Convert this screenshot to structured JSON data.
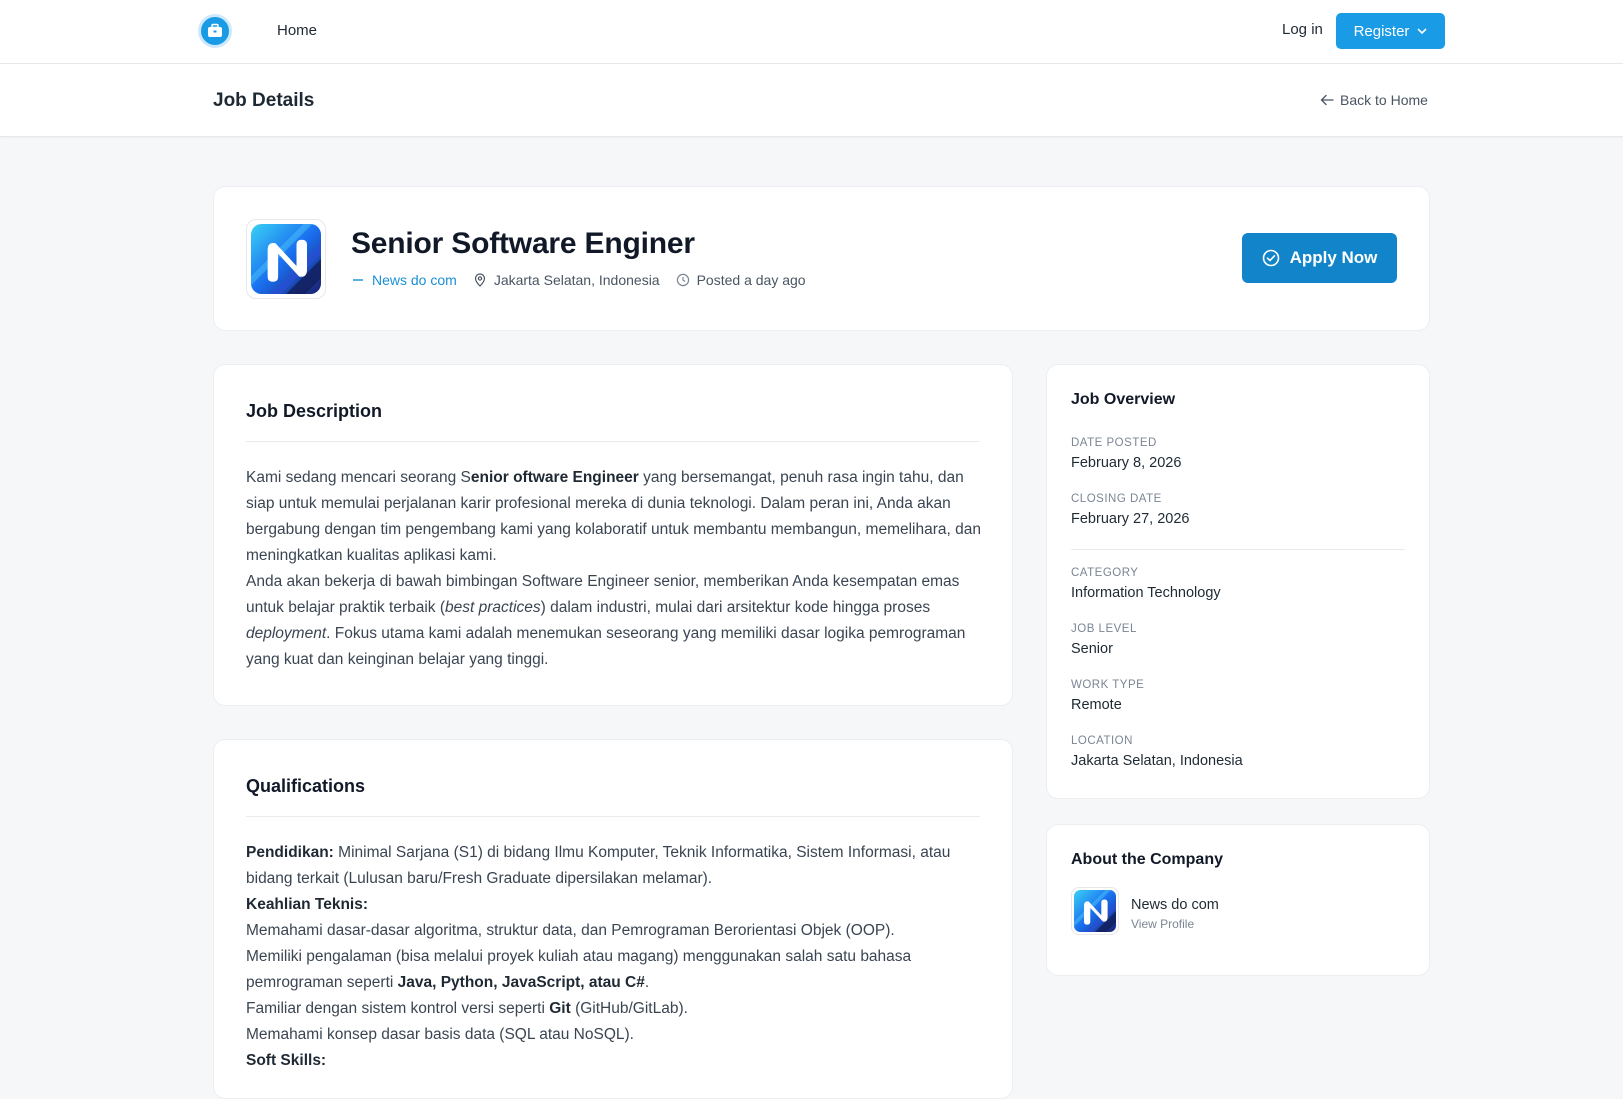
{
  "nav": {
    "home_label": "Home",
    "login_label": "Log in",
    "register_label": "Register"
  },
  "subheader": {
    "title": "Job Details",
    "back_label": "Back to Home"
  },
  "job": {
    "title": "Senior Software Enginer",
    "company": "News do com",
    "location": "Jakarta Selatan, Indonesia",
    "posted": "Posted a day ago",
    "apply_label": "Apply Now"
  },
  "description": {
    "title": "Job Description",
    "p1_a": "Kami sedang mencari seorang S",
    "p1_b": "enior oftware Engineer",
    "p1_c": " yang bersemangat, penuh rasa ingin tahu, dan siap untuk memulai perjalanan karir profesional mereka di dunia teknologi. Dalam peran ini, Anda akan bergabung dengan tim pengembang kami yang kolaboratif untuk membantu membangun, memelihara, dan meningkatkan kualitas aplikasi kami.",
    "p2_a": "Anda akan bekerja di bawah bimbingan Software Engineer senior, memberikan Anda kesempatan emas untuk belajar praktik terbaik (",
    "p2_b": "best practices",
    "p2_c": ") dalam industri, mulai dari arsitektur kode hingga proses ",
    "p2_d": "deployment",
    "p2_e": ". Fokus utama kami adalah menemukan seseorang yang memiliki dasar logika pemrograman yang kuat dan keinginan belajar yang tinggi."
  },
  "qualifications": {
    "title": "Qualifications",
    "edu_label": "Pendidikan:",
    "edu_text": " Minimal Sarjana (S1) di bidang Ilmu Komputer, Teknik Informatika, Sistem Informasi, atau bidang terkait (Lulusan baru/Fresh Graduate dipersilakan melamar).",
    "tech_label": "Keahlian Teknis:",
    "tech_1": "Memahami dasar-dasar algoritma, struktur data, dan Pemrograman Berorientasi Objek (OOP).",
    "tech_2_a": "Memiliki pengalaman (bisa melalui proyek kuliah atau magang) menggunakan salah satu bahasa pemrograman seperti ",
    "tech_2_b": "Java, Python, JavaScript, atau C#",
    "tech_2_c": ".",
    "tech_3_a": "Familiar dengan sistem kontrol versi seperti ",
    "tech_3_b": "Git",
    "tech_3_c": " (GitHub/GitLab).",
    "tech_4": "Memahami konsep dasar basis data (SQL atau NoSQL).",
    "soft_label": "Soft Skills:"
  },
  "overview": {
    "title": "Job Overview",
    "date_posted_label": "DATE POSTED",
    "date_posted": "February 8, 2026",
    "closing_label": "CLOSING DATE",
    "closing": "February 27, 2026",
    "category_label": "CATEGORY",
    "category": "Information Technology",
    "level_label": "JOB LEVEL",
    "level": "Senior",
    "worktype_label": "WORK TYPE",
    "worktype": "Remote",
    "location_label": "LOCATION",
    "location": "Jakarta Selatan, Indonesia"
  },
  "company_card": {
    "title": "About the Company",
    "name": "News do com",
    "link": "View Profile"
  },
  "colors": {
    "primary": "#1a9be6",
    "apply": "#1284c9",
    "link": "#1a8fd6"
  }
}
